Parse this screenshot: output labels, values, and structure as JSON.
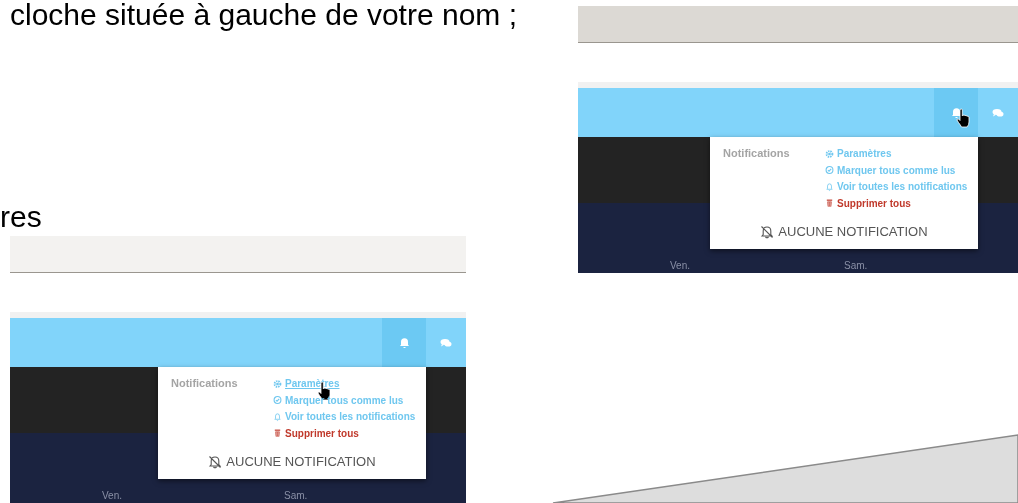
{
  "text_lines": [
    "cloche située à gauche de votre nom ;",
    "res"
  ],
  "screenshots": [
    {
      "header": {
        "bell_active": true,
        "bell_hovered": true
      },
      "dropdown": {
        "title": "Notifications",
        "actions": [
          {
            "kind": "settings",
            "label": "Paramètres",
            "hovered": false
          },
          {
            "kind": "mark-read",
            "label": "Marquer tous comme lus",
            "hovered": false
          },
          {
            "kind": "view-all",
            "label": "Voir toutes les notifications",
            "hovered": false
          },
          {
            "kind": "delete",
            "label": "Supprimer tous",
            "hovered": false
          }
        ],
        "empty_message": "AUCUNE NOTIFICATION"
      },
      "days": [
        "Ven.",
        "Sam."
      ]
    },
    {
      "header": {
        "bell_active": true,
        "bell_hovered": false
      },
      "dropdown": {
        "title": "Notifications",
        "actions": [
          {
            "kind": "settings",
            "label": "Paramètres",
            "hovered": true
          },
          {
            "kind": "mark-read",
            "label": "Marquer tous comme lus",
            "hovered": false
          },
          {
            "kind": "view-all",
            "label": "Voir toutes les notifications",
            "hovered": false
          },
          {
            "kind": "delete",
            "label": "Supprimer tous",
            "hovered": false
          }
        ],
        "empty_message": "AUCUNE NOTIFICATION"
      },
      "days": [
        "Ven.",
        "Sam."
      ]
    }
  ]
}
